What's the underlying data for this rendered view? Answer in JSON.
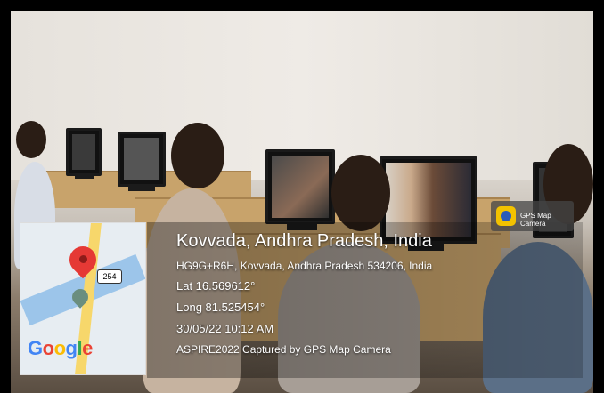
{
  "overlay": {
    "location_title": "Kovvada, Andhra Pradesh, India",
    "address": "HG9G+R6H, Kovvada, Andhra Pradesh 534206, India",
    "latitude": "Lat 16.569612°",
    "longitude": "Long 81.525454°",
    "datetime": "30/05/22 10:12 AM",
    "caption": "ASPIRE2022 Captured by GPS Map Camera"
  },
  "map": {
    "logo_text": "Google",
    "road_shield": "254",
    "pin_color": "#e53935"
  },
  "badge": {
    "label": "GPS Map Camera"
  }
}
